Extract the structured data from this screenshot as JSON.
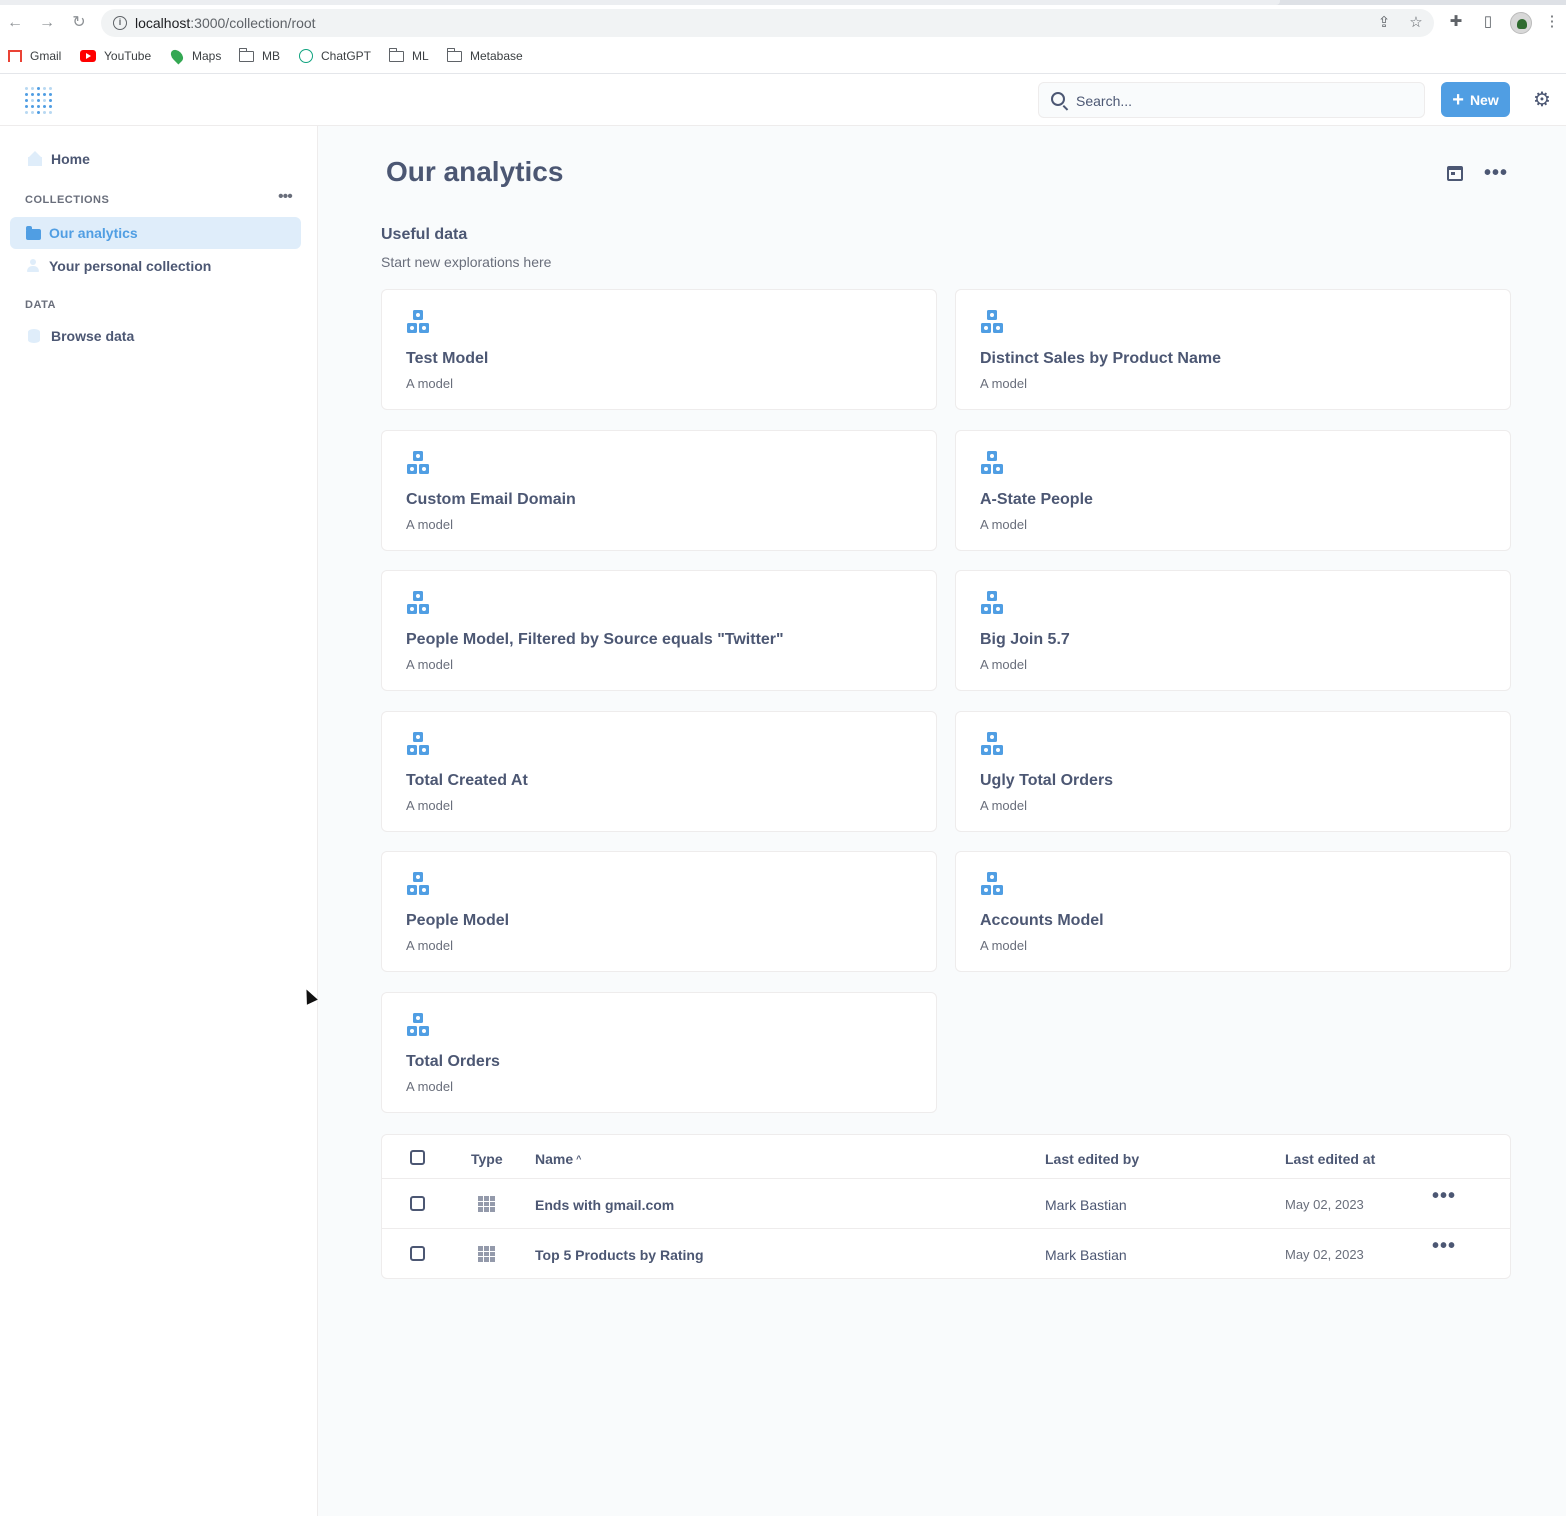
{
  "browser": {
    "url_host": "localhost",
    "url_path": ":3000/collection/root",
    "bookmarks": [
      "Gmail",
      "YouTube",
      "Maps",
      "MB",
      "ChatGPT",
      "ML",
      "Metabase"
    ]
  },
  "header": {
    "search_placeholder": "Search...",
    "new_label": "New"
  },
  "sidebar": {
    "home": "Home",
    "collections_heading": "COLLECTIONS",
    "collections": [
      "Our analytics",
      "Your personal collection"
    ],
    "data_heading": "DATA",
    "browse_data": "Browse data"
  },
  "main": {
    "title": "Our analytics",
    "pinned_title": "Useful data",
    "pinned_subtitle": "Start new explorations here",
    "models": [
      {
        "name": "Test Model",
        "desc": "A model"
      },
      {
        "name": "Distinct Sales by Product Name",
        "desc": "A model"
      },
      {
        "name": "Custom Email Domain",
        "desc": "A model"
      },
      {
        "name": "A-State People",
        "desc": "A model"
      },
      {
        "name": "People Model, Filtered by Source equals \"Twitter\"",
        "desc": "A model"
      },
      {
        "name": "Big Join 5.7",
        "desc": "A model"
      },
      {
        "name": "Total Created At",
        "desc": "A model"
      },
      {
        "name": "Ugly Total Orders",
        "desc": "A model"
      },
      {
        "name": "People Model",
        "desc": "A model"
      },
      {
        "name": "Accounts Model",
        "desc": "A model"
      },
      {
        "name": "Total Orders",
        "desc": "A model"
      }
    ],
    "table": {
      "headers": {
        "type": "Type",
        "name": "Name",
        "sort_indicator": "^",
        "edited_by": "Last edited by",
        "edited_at": "Last edited at"
      },
      "rows": [
        {
          "name": "Ends with gmail.com",
          "edited_by": "Mark Bastian",
          "edited_at": "May 02, 2023"
        },
        {
          "name": "Top 5 Products by Rating",
          "edited_by": "Mark Bastian",
          "edited_at": "May 02, 2023"
        }
      ]
    }
  },
  "colors": {
    "brand": "#509ee3",
    "text": "#4c5773",
    "active_bg": "#dfedfa"
  }
}
